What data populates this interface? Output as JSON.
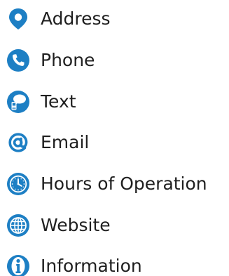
{
  "colors": {
    "icon_blue": "#1d7fc4",
    "text": "#1f1f1f"
  },
  "contact_list": {
    "items": [
      {
        "label": "Address",
        "icon": "map-pin-icon"
      },
      {
        "label": "Phone",
        "icon": "phone-icon"
      },
      {
        "label": "Text",
        "icon": "text-message-icon"
      },
      {
        "label": "Email",
        "icon": "at-sign-icon"
      },
      {
        "label": "Hours of Operation",
        "icon": "clock-icon"
      },
      {
        "label": "Website",
        "icon": "globe-icon"
      },
      {
        "label": "Information",
        "icon": "info-icon"
      }
    ]
  }
}
